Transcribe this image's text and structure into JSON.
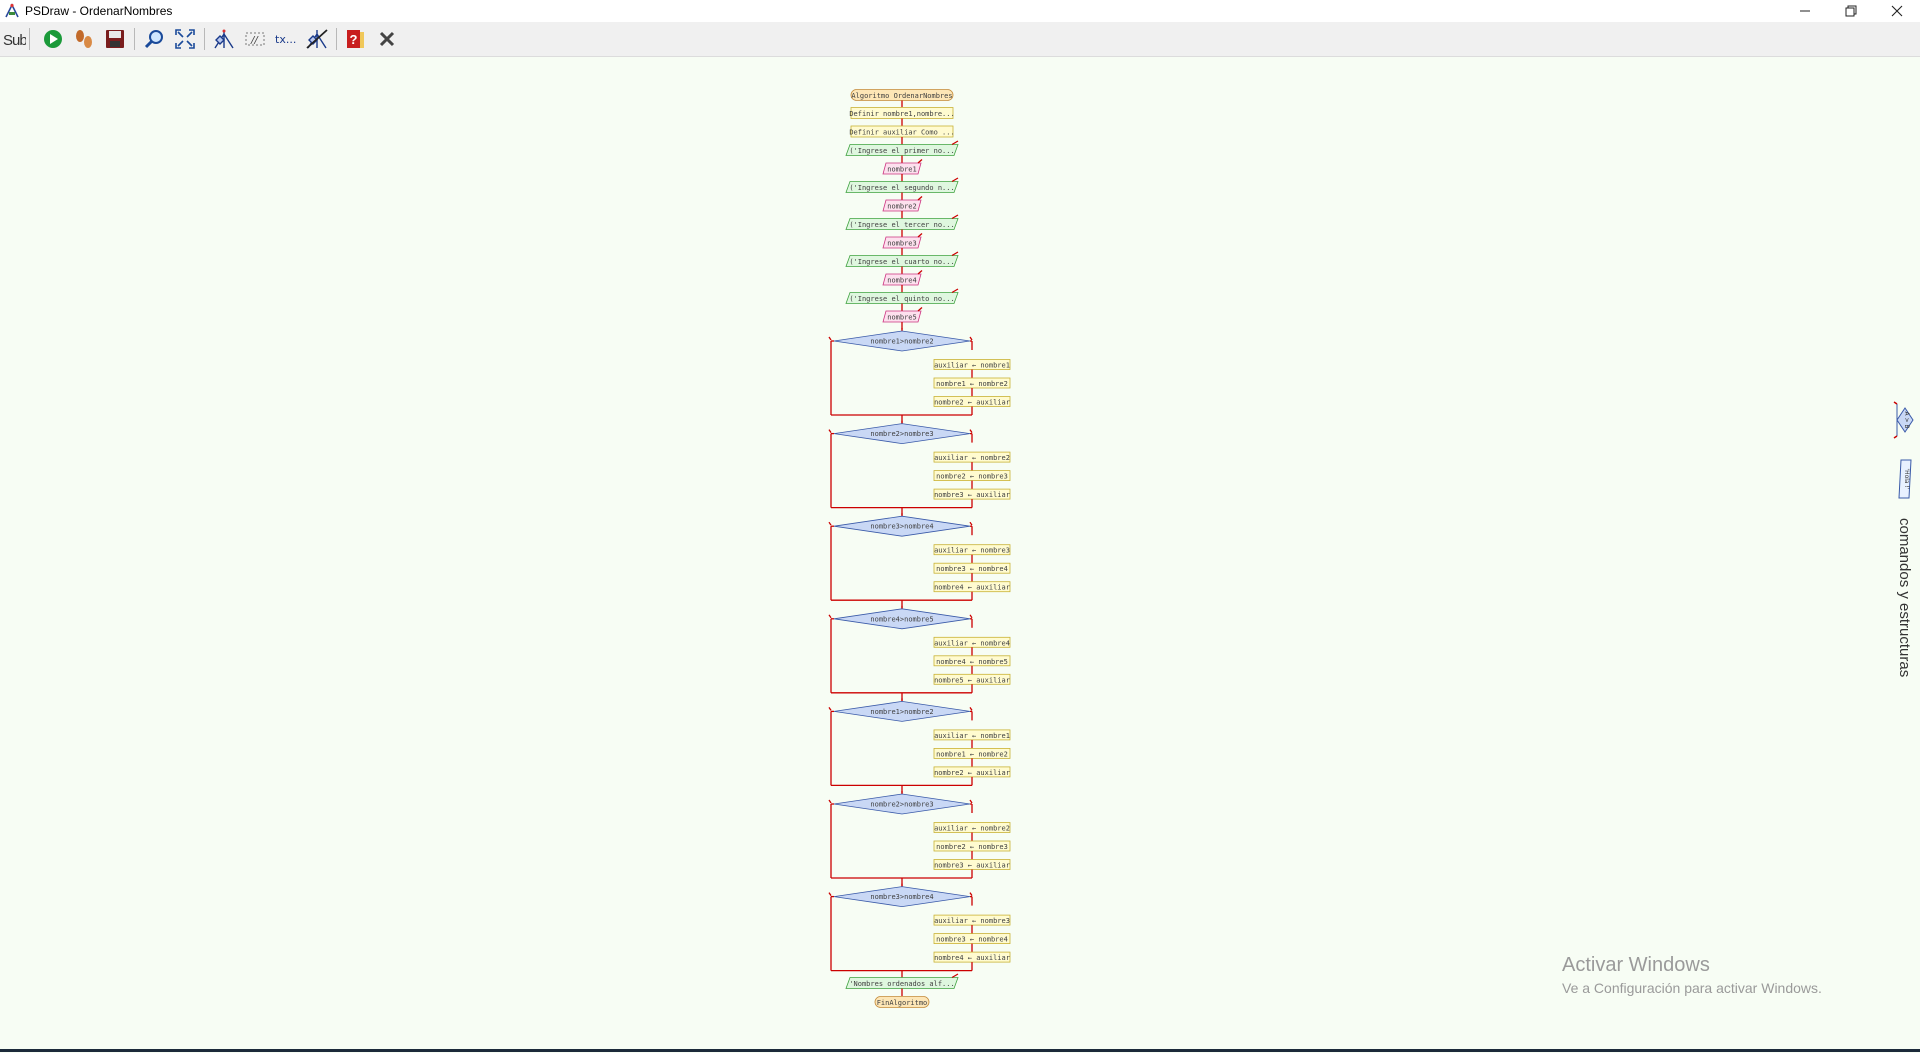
{
  "window": {
    "title": "PSDraw - OrdenarNombres",
    "minimize_icon": "minimize-icon",
    "maximize_icon": "restore-icon",
    "close_icon": "close-icon"
  },
  "toolbar": {
    "items": [
      {
        "name": "sub-button",
        "label": "Sub"
      },
      {
        "name": "run-button",
        "icon": "play-icon"
      },
      {
        "name": "step-button",
        "icon": "footsteps-icon"
      },
      {
        "name": "save-button",
        "icon": "floppy-icon"
      },
      {
        "name": "zoom-button",
        "icon": "magnifier-icon"
      },
      {
        "name": "fit-button",
        "icon": "expand-icon"
      },
      {
        "name": "style-button",
        "icon": "flowchart-icon"
      },
      {
        "name": "comments-button",
        "label": "//"
      },
      {
        "name": "text-button",
        "label": "tx..."
      },
      {
        "name": "crossed-button",
        "icon": "crossed-diagram-icon"
      },
      {
        "name": "help-button",
        "icon": "help-icon"
      },
      {
        "name": "close-diagram-button",
        "icon": "x-icon"
      }
    ]
  },
  "flowchart": {
    "start": "Algoritmo OrdenarNombres",
    "defs": [
      "Definir nombre1,nombre...",
      "Definir auxiliar Como ..."
    ],
    "io": [
      {
        "out": "('Ingrese el primer no...",
        "in": "nombre1"
      },
      {
        "out": "('Ingrese el segundo n...",
        "in": "nombre2"
      },
      {
        "out": "('Ingrese el tercer no...",
        "in": "nombre3"
      },
      {
        "out": "('Ingrese el cuarto no...",
        "in": "nombre4"
      },
      {
        "out": "('Ingrese el quinto no...",
        "in": "nombre5"
      }
    ],
    "ifs": [
      {
        "cond": "nombre1>nombre2",
        "actions": [
          "auxiliar ← nombre1",
          "nombre1 ← nombre2",
          "nombre2 ← auxiliar"
        ]
      },
      {
        "cond": "nombre2>nombre3",
        "actions": [
          "auxiliar ← nombre2",
          "nombre2 ← nombre3",
          "nombre3 ← auxiliar"
        ]
      },
      {
        "cond": "nombre3>nombre4",
        "actions": [
          "auxiliar ← nombre3",
          "nombre3 ← nombre4",
          "nombre4 ← auxiliar"
        ]
      },
      {
        "cond": "nombre4>nombre5",
        "actions": [
          "auxiliar ← nombre4",
          "nombre4 ← nombre5",
          "nombre5 ← auxiliar"
        ]
      },
      {
        "cond": "nombre1>nombre2",
        "actions": [
          "auxiliar ← nombre1",
          "nombre1 ← nombre2",
          "nombre2 ← auxiliar"
        ]
      },
      {
        "cond": "nombre2>nombre3",
        "actions": [
          "auxiliar ← nombre2",
          "nombre2 ← nombre3",
          "nombre3 ← auxiliar"
        ]
      },
      {
        "cond": "nombre3>nombre4",
        "actions": [
          "auxiliar ← nombre3",
          "nombre3 ← nombre4",
          "nombre4 ← auxiliar"
        ]
      }
    ],
    "final_output": "'Nombres ordenados alf...",
    "end": "FinAlgoritmo"
  },
  "side_panel": {
    "label": "comandos y estructuras",
    "mini_items": [
      "A > B",
      "'Hola !'"
    ]
  },
  "watermark": {
    "line1": "Activar Windows",
    "line2": "Ve a Configuración para activar Windows."
  },
  "colors": {
    "canvas_bg": "#f7fdf4",
    "connector": "#cc0000",
    "start_end_fill": "#fde6b6",
    "start_end_stroke": "#c38a3a",
    "assign_fill": "#fffbd0",
    "assign_stroke": "#c9b235",
    "output_fill": "#dff7df",
    "output_stroke": "#3fa23f",
    "input_fill": "#fde0ee",
    "input_stroke": "#cc3380",
    "decision_fill": "#c9d8f5",
    "decision_stroke": "#3a5aa8",
    "text": "#404040"
  }
}
